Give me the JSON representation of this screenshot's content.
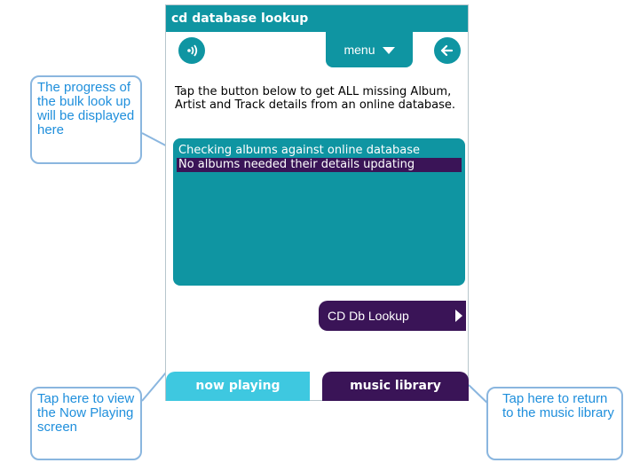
{
  "window": {
    "title": "cd database lookup"
  },
  "toolbar": {
    "left_icon": "radio-signal-icon",
    "menu_label": "menu",
    "menu_icon": "caret-down-icon",
    "back_icon": "back-arrow-icon"
  },
  "main": {
    "instruction": "Tap the button below to get ALL missing Album, Artist and Track details from an online database.",
    "log_lines": [
      "Checking albums against online database",
      "No albums needed their details updating"
    ],
    "lookup_button": "CD Db Lookup"
  },
  "tabs": {
    "now_playing": "now playing",
    "music_library": "music library"
  },
  "callouts": {
    "progress": "The progress of the bulk look up will be displayed here",
    "now_playing": "Tap here to view the Now Playing screen",
    "library": "Tap here to return to the music library"
  },
  "colors": {
    "teal": "#0f95a2",
    "light_teal": "#3ec8e0",
    "purple": "#3a1457",
    "callout_border": "#8ab6df",
    "callout_text": "#1f8fdc"
  }
}
